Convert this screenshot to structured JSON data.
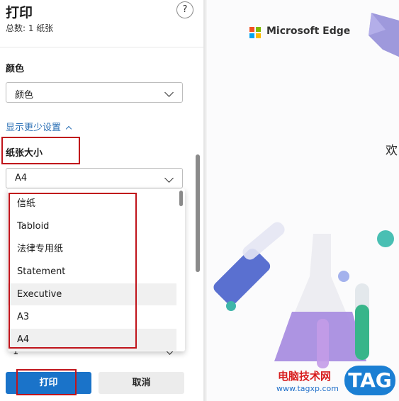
{
  "dialog": {
    "title": "打印",
    "total_pages": "总数: 1 纸张",
    "help_label": "?"
  },
  "color": {
    "label": "颜色",
    "value": "颜色"
  },
  "settings_toggle": "显示更少设置",
  "paper_size": {
    "label": "纸张大小",
    "value": "A4",
    "options": [
      "信纸",
      "Tabloid",
      "法律专用纸",
      "Statement",
      "Executive",
      "A3",
      "A4"
    ],
    "hovered": [
      "Executive",
      "A4"
    ]
  },
  "hidden_select_value": "1",
  "buttons": {
    "print": "打印",
    "cancel": "取消"
  },
  "preview": {
    "brand": "Microsoft Edge",
    "welcome_text": "欢",
    "watermark_text": "电脑技术网",
    "watermark_url": "www.tagxp.com",
    "watermark_tag": "TAG"
  },
  "colors": {
    "primary_button": "#1a73c9",
    "link": "#2a6fb5",
    "highlight_box": "#c0141b"
  }
}
